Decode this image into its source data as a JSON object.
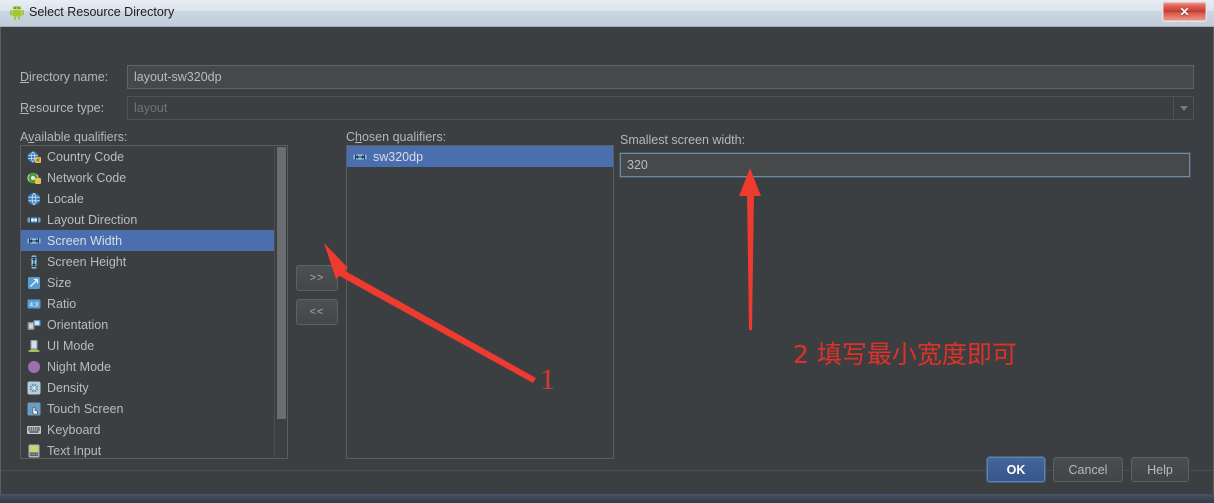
{
  "window": {
    "title": "Select Resource Directory",
    "app_icon": "android-robot-icon",
    "close_label": "✕"
  },
  "form": {
    "directory_name": {
      "label": "Directory name:",
      "mnemonic": "D",
      "value": "layout-sw320dp"
    },
    "resource_type": {
      "label": "Resource type:",
      "mnemonic": "R",
      "value": "layout",
      "disabled": true
    }
  },
  "available": {
    "label": "Available qualifiers:",
    "mnemonic": "A",
    "items": [
      {
        "label": "Country Code",
        "icon": "country-code-icon",
        "selected": false
      },
      {
        "label": "Network Code",
        "icon": "network-code-icon",
        "selected": false
      },
      {
        "label": "Locale",
        "icon": "locale-globe-icon",
        "selected": false
      },
      {
        "label": "Layout Direction",
        "icon": "layout-direction-icon",
        "selected": false
      },
      {
        "label": "Screen Width",
        "icon": "screen-width-icon",
        "selected": true
      },
      {
        "label": "Screen Height",
        "icon": "screen-height-icon",
        "selected": false
      },
      {
        "label": "Size",
        "icon": "size-icon",
        "selected": false
      },
      {
        "label": "Ratio",
        "icon": "ratio-icon",
        "selected": false
      },
      {
        "label": "Orientation",
        "icon": "orientation-icon",
        "selected": false
      },
      {
        "label": "UI Mode",
        "icon": "ui-mode-icon",
        "selected": false
      },
      {
        "label": "Night Mode",
        "icon": "night-mode-icon",
        "selected": false
      },
      {
        "label": "Density",
        "icon": "density-icon",
        "selected": false
      },
      {
        "label": "Touch Screen",
        "icon": "touch-screen-icon",
        "selected": false
      },
      {
        "label": "Keyboard",
        "icon": "keyboard-icon",
        "selected": false
      },
      {
        "label": "Text Input",
        "icon": "text-input-icon",
        "selected": false
      }
    ]
  },
  "transfer": {
    "add_label": ">>",
    "remove_label": "<<"
  },
  "chosen": {
    "label": "Chosen qualifiers:",
    "mnemonic": "h",
    "items": [
      {
        "label": "sw320dp",
        "icon": "screen-width-icon",
        "selected": true
      }
    ]
  },
  "detail": {
    "label": "Smallest screen width:",
    "value": "320"
  },
  "buttons": {
    "ok": "OK",
    "cancel": "Cancel",
    "help": "Help"
  },
  "annotations": {
    "step1": "1",
    "step2": "2 填写最小宽度即可"
  },
  "colors": {
    "panel_bg": "#3c3f41",
    "selection_blue": "#4b6eaf",
    "accent_red": "#e03127",
    "default_button_blue": "#3d5f96",
    "close_red": "#c23b2d"
  }
}
